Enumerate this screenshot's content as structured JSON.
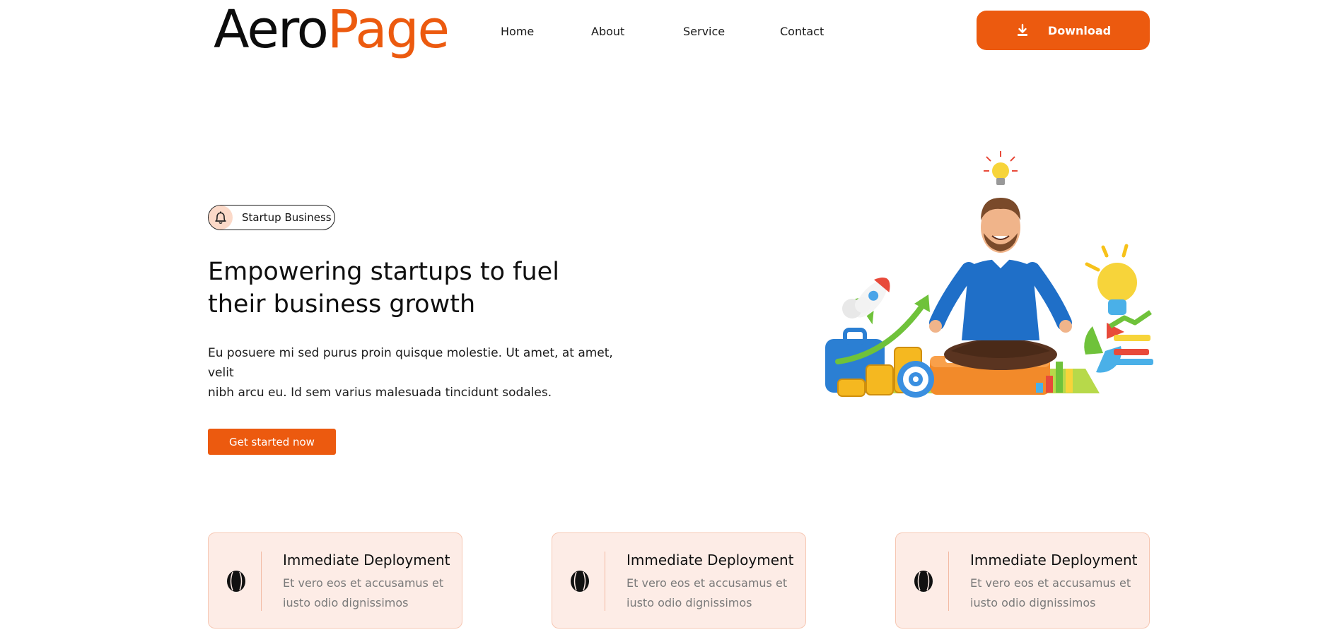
{
  "brand": {
    "part1": "Aero",
    "part2": "Page",
    "color_dark": "#0c0c0c",
    "color_accent": "#ec5a0f"
  },
  "nav": {
    "items": [
      "Home",
      "About",
      "Service",
      "Contact"
    ]
  },
  "header": {
    "download_label": "Download",
    "download_icon": "download-icon"
  },
  "hero": {
    "badge_label": "Startup Business",
    "badge_icon": "bell-icon",
    "headline_line1": "Empowering startups to fuel",
    "headline_line2": "their business growth",
    "desc_line1": "Eu posuere mi sed purus proin quisque molestie. Ut amet, at amet,",
    "desc_line2": "velit",
    "desc_line3": "nibh arcu eu. Id sem varius malesuada tincidunt sodales.",
    "cta_label": "Get started now",
    "illustration": "meditating-businessman-illustration"
  },
  "features": [
    {
      "title": "Immediate Deployment",
      "text": "Et vero eos et accusamus et iusto odio dignissimos",
      "icon": "baseball-icon"
    },
    {
      "title": "Immediate Deployment",
      "text": "Et vero eos et accusamus et iusto odio dignissimos",
      "icon": "baseball-icon"
    },
    {
      "title": "Immediate Deployment",
      "text": "Et vero eos et accusamus et iusto odio dignissimos",
      "icon": "baseball-icon"
    }
  ]
}
